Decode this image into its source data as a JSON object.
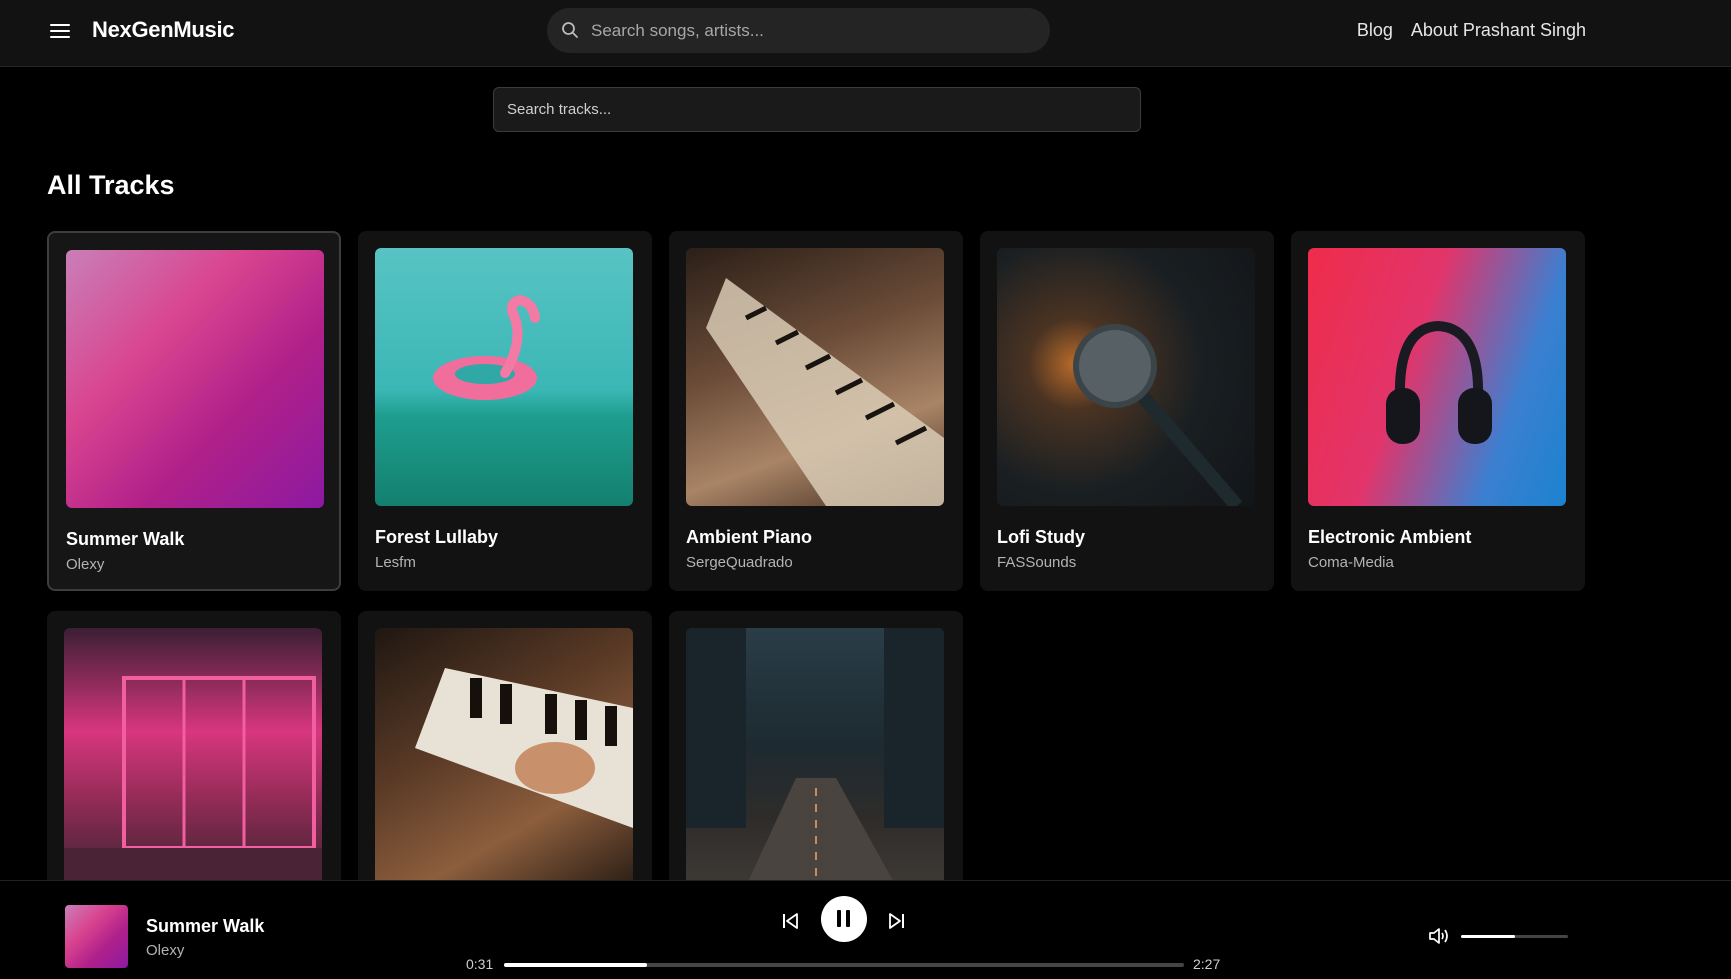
{
  "header": {
    "brand": "NexGenMusic",
    "search_placeholder": "Search songs, artists...",
    "links": [
      "Blog",
      "About Prashant Singh"
    ]
  },
  "track_search": {
    "placeholder": "Search tracks..."
  },
  "section_title": "All Tracks",
  "tracks": [
    {
      "title": "Summer Walk",
      "artist": "Olexy",
      "selected": true
    },
    {
      "title": "Forest Lullaby",
      "artist": "Lesfm"
    },
    {
      "title": "Ambient Piano",
      "artist": "SergeQuadrado"
    },
    {
      "title": "Lofi Study",
      "artist": "FASSounds"
    },
    {
      "title": "Electronic Ambient",
      "artist": "Coma-Media"
    },
    {
      "title": "",
      "artist": ""
    },
    {
      "title": "",
      "artist": ""
    },
    {
      "title": "",
      "artist": ""
    }
  ],
  "player": {
    "title": "Summer Walk",
    "artist": "Olexy",
    "current_time": "0:31",
    "duration": "2:27",
    "progress": 0.21,
    "volume": 0.5
  },
  "icons": {
    "menu": "menu-icon",
    "search": "search-icon",
    "prev": "skip-back-icon",
    "play_pause": "pause-icon",
    "next": "skip-forward-icon",
    "volume": "volume-icon"
  }
}
